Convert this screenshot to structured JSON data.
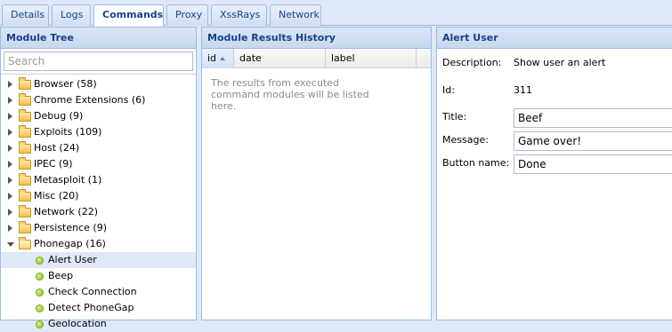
{
  "tabs": [
    {
      "label": "Details"
    },
    {
      "label": "Logs"
    },
    {
      "label": "Commands"
    },
    {
      "label": "Proxy"
    },
    {
      "label": "XssRays"
    },
    {
      "label": "Network"
    }
  ],
  "module_tree": {
    "title": "Module Tree",
    "search_placeholder": "Search",
    "folders": [
      {
        "label": "Browser (58)"
      },
      {
        "label": "Chrome Extensions (6)"
      },
      {
        "label": "Debug (9)"
      },
      {
        "label": "Exploits (109)"
      },
      {
        "label": "Host (24)"
      },
      {
        "label": "IPEC (9)"
      },
      {
        "label": "Metasploit (1)"
      },
      {
        "label": "Misc (20)"
      },
      {
        "label": "Network (22)"
      },
      {
        "label": "Persistence (9)"
      },
      {
        "label": "Phonegap (16)"
      }
    ],
    "phonegap_children": [
      {
        "label": "Alert User"
      },
      {
        "label": "Beep"
      },
      {
        "label": "Check Connection"
      },
      {
        "label": "Detect PhoneGap"
      },
      {
        "label": "Geolocation"
      }
    ]
  },
  "history": {
    "title": "Module Results History",
    "columns": [
      "id",
      "date",
      "label"
    ],
    "empty_message": "The results from executed command modules will be listed here."
  },
  "alert_user": {
    "title": "Alert User",
    "description_label": "Description:",
    "description_value": "Show user an alert",
    "id_label": "Id:",
    "id_value": "311",
    "title_label": "Title:",
    "title_value": "Beef",
    "message_label": "Message:",
    "message_value": "Game over!",
    "button_label": "Button name:",
    "button_value": "Done"
  },
  "colors": {
    "header_text": "#15428b",
    "border": "#99bbe8",
    "selected_row": "#dfe8f6",
    "leaf_icon": "#8ac11c"
  }
}
